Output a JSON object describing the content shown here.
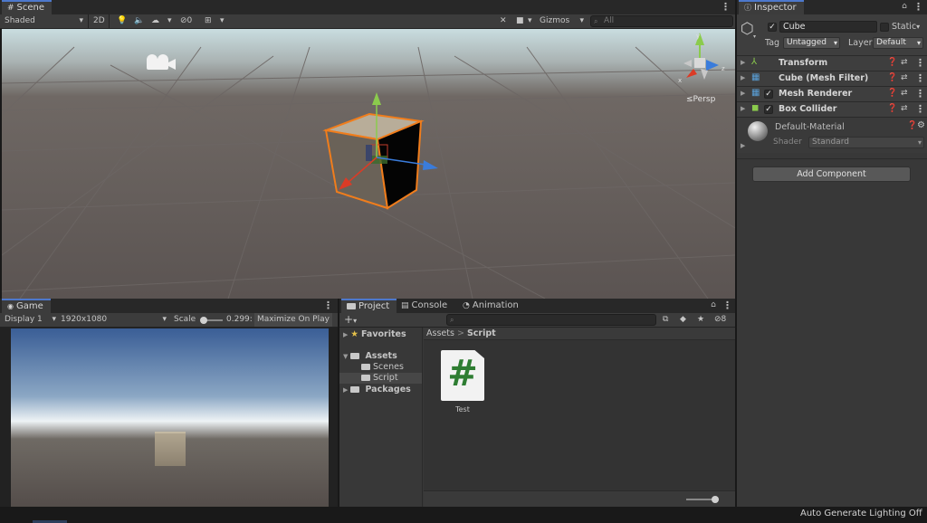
{
  "scene": {
    "tab_label": "Scene",
    "toolbar": {
      "shading_mode": "Shaded",
      "btn_2d": "2D",
      "gizmo_layers_count": "0",
      "gizmos_label": "Gizmos",
      "search_placeholder": "All"
    },
    "view": {
      "persp_label": "Persp",
      "axis_x": "x",
      "axis_y": "y",
      "axis_z": "z"
    }
  },
  "game": {
    "tab_label": "Game",
    "toolbar": {
      "display": "Display 1",
      "resolution": "1920x1080",
      "scale_label": "Scale",
      "scale_value": "0.299:",
      "maximize_label": "Maximize On Play"
    }
  },
  "project": {
    "tabs": [
      {
        "label": "Project",
        "icon": "folder-icon"
      },
      {
        "label": "Console",
        "icon": "console-icon"
      },
      {
        "label": "Animation",
        "icon": "animation-icon"
      }
    ],
    "hidden_count": "8",
    "breadcrumb": [
      "Assets",
      "Script"
    ],
    "tree": {
      "favorites": "Favorites",
      "assets": "Assets",
      "assets_children": [
        "Scenes",
        "Script"
      ],
      "packages": "Packages"
    },
    "files": [
      {
        "name": "Test",
        "icon": "csharp-script-icon",
        "glyph": "#"
      }
    ]
  },
  "inspector": {
    "tab_label": "Inspector",
    "object_name": "Cube",
    "static_label": "Static",
    "tag_label": "Tag",
    "tag_value": "Untagged",
    "layer_label": "Layer",
    "layer_value": "Default",
    "components": [
      {
        "name": "Transform",
        "has_checkbox": false,
        "icon": "transform-icon"
      },
      {
        "name": "Cube (Mesh Filter)",
        "has_checkbox": false,
        "icon": "mesh-filter-icon"
      },
      {
        "name": "Mesh Renderer",
        "has_checkbox": true,
        "icon": "mesh-renderer-icon"
      },
      {
        "name": "Box Collider",
        "has_checkbox": true,
        "icon": "box-collider-icon"
      }
    ],
    "material": {
      "name": "Default-Material",
      "shader_label": "Shader",
      "shader_value": "Standard"
    },
    "add_component_label": "Add Component"
  },
  "status_bar": {
    "text": "Auto Generate Lighting Off"
  },
  "colors": {
    "selection_outline": "#f07d1c",
    "accent_tab": "#4d78cc",
    "axis_x": "#db3b26",
    "axis_y": "#8bcb4d",
    "axis_z": "#3a7cdb",
    "csharp_green": "#2e7d32"
  }
}
